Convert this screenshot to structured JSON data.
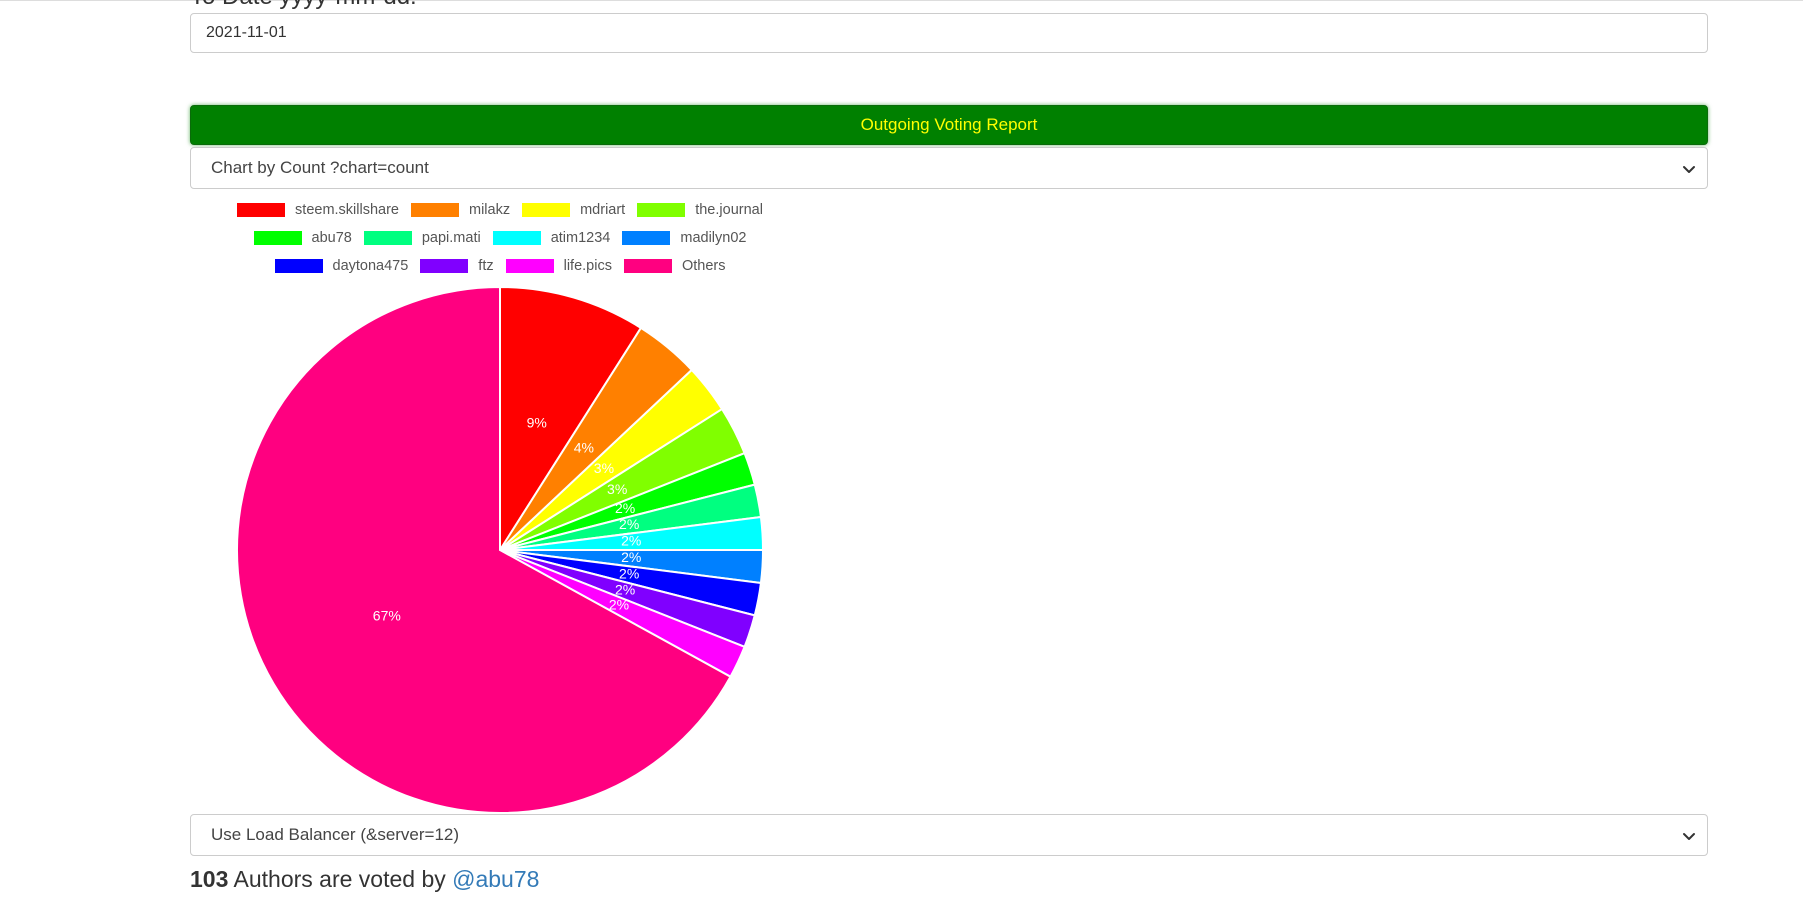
{
  "form": {
    "to_date_label": "To Date yyyy-mm-dd:",
    "to_date_value": "2021-11-01"
  },
  "report": {
    "header": "Outgoing Voting Report",
    "chart_select_value": "Chart by Count ?chart=count",
    "server_select_value": "Use Load Balancer (&server=12)"
  },
  "summary": {
    "count": "103",
    "text": "Authors are voted by",
    "user": "@abu78"
  },
  "chart_data": {
    "type": "pie",
    "legend_position": "top",
    "categories": [
      "steem.skillshare",
      "milakz",
      "mdriart",
      "the.journal",
      "abu78",
      "papi.mati",
      "atim1234",
      "madilyn02",
      "daytona475",
      "ftz",
      "life.pics",
      "Others"
    ],
    "values": [
      9,
      4,
      3,
      3,
      2,
      2,
      2,
      2,
      2,
      2,
      2,
      67
    ],
    "labels": [
      "9%",
      "4%",
      "3%",
      "3%",
      "2%",
      "2%",
      "2%",
      "2%",
      "2%",
      "2%",
      "2%",
      "67%"
    ],
    "colors": [
      "#ff0000",
      "#ff8000",
      "#ffff00",
      "#80ff00",
      "#00ff00",
      "#00ff80",
      "#00ffff",
      "#0080ff",
      "#0000ff",
      "#8000ff",
      "#ff00ff",
      "#ff0080"
    ]
  }
}
